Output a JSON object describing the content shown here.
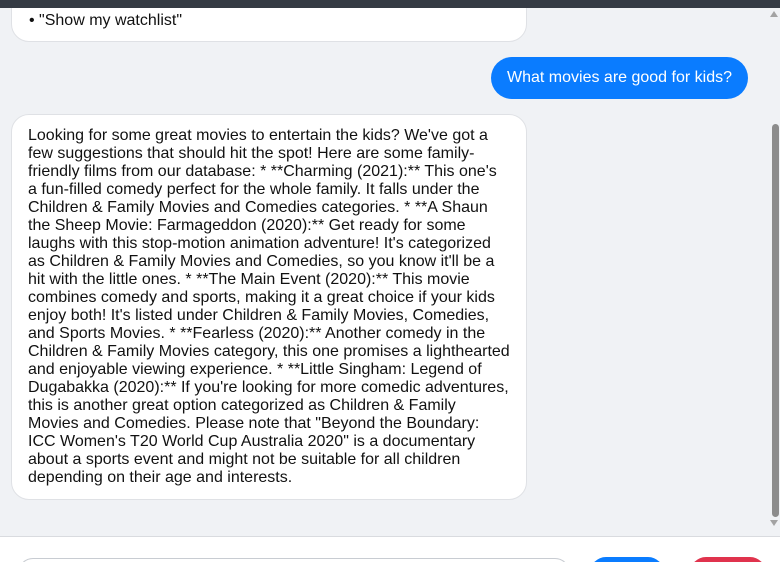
{
  "conversation": {
    "previous_bot_tail": "• \"Show my watchlist\"",
    "user_message": "What movies are good for kids?",
    "bot_reply": "Looking for some great movies to entertain the kids? We've got a few suggestions that should hit the spot! Here are some family-friendly films from our database: * **Charming (2021):** This one's a fun-filled comedy perfect for the whole family. It falls under the Children & Family Movies and Comedies categories. * **A Shaun the Sheep Movie: Farmageddon (2020):** Get ready for some laughs with this stop-motion animation adventure! It's categorized as Children & Family Movies and Comedies, so you know it'll be a hit with the little ones. * **The Main Event (2020):** This movie combines comedy and sports, making it a great choice if your kids enjoy both! It's listed under Children & Family Movies, Comedies, and Sports Movies. * **Fearless (2020):** Another comedy in the Children & Family Movies category, this one promises a lighthearted and enjoyable viewing experience. * **Little Singham: Legend of Dugabakka (2020):** If you're looking for more comedic adventures, this is another great option categorized as Children & Family Movies and Comedies. Please note that \"Beyond the Boundary: ICC Women's T20 World Cup Australia 2020\" is a documentary about a sports event and might not be suitable for all children depending on their age and interests.",
    "bot_reply_lines": [
      "Looking for some great movies to entertain the kids? We've got a",
      "few suggestions that should hit the spot! Here are some family-",
      "friendly films from our database: * **Charming (2021):** This one's",
      "a fun-filled comedy perfect for the whole family. It falls under the",
      "Children & Family Movies and Comedies categories. * **A Shaun",
      "the Sheep Movie: Farmageddon (2020):** Get ready for some",
      "laughs with this stop-motion animation adventure! It's categorized",
      "as Children & Family Movies and Comedies, so you know it'll be a",
      "hit with the little ones. * **The Main Event (2020):** This movie",
      "combines comedy and sports, making it a great choice if your kids",
      "enjoy both! It's listed under Children & Family Movies, Comedies,",
      "and Sports Movies. * **Fearless (2020):** Another comedy in the",
      "Children & Family Movies category, this one promises a lighthearted",
      "and enjoyable viewing experience. * **Little Singham: Legend of",
      "Dugabakka (2020):** If you're looking for more comedic adventures,",
      "this is another great option categorized as Children & Family",
      "Movies and Comedies. Please note that \"Beyond the Boundary:",
      "ICC Women's T20 World Cup Australia 2020\" is a documentary",
      "about a sports event and might not be suitable for all children",
      "depending on their age and interests."
    ]
  },
  "colors": {
    "user_bubble": "#0a7cff",
    "bot_bubble": "#ffffff",
    "background": "#f0f2f5",
    "clear_button": "#e0334d"
  }
}
